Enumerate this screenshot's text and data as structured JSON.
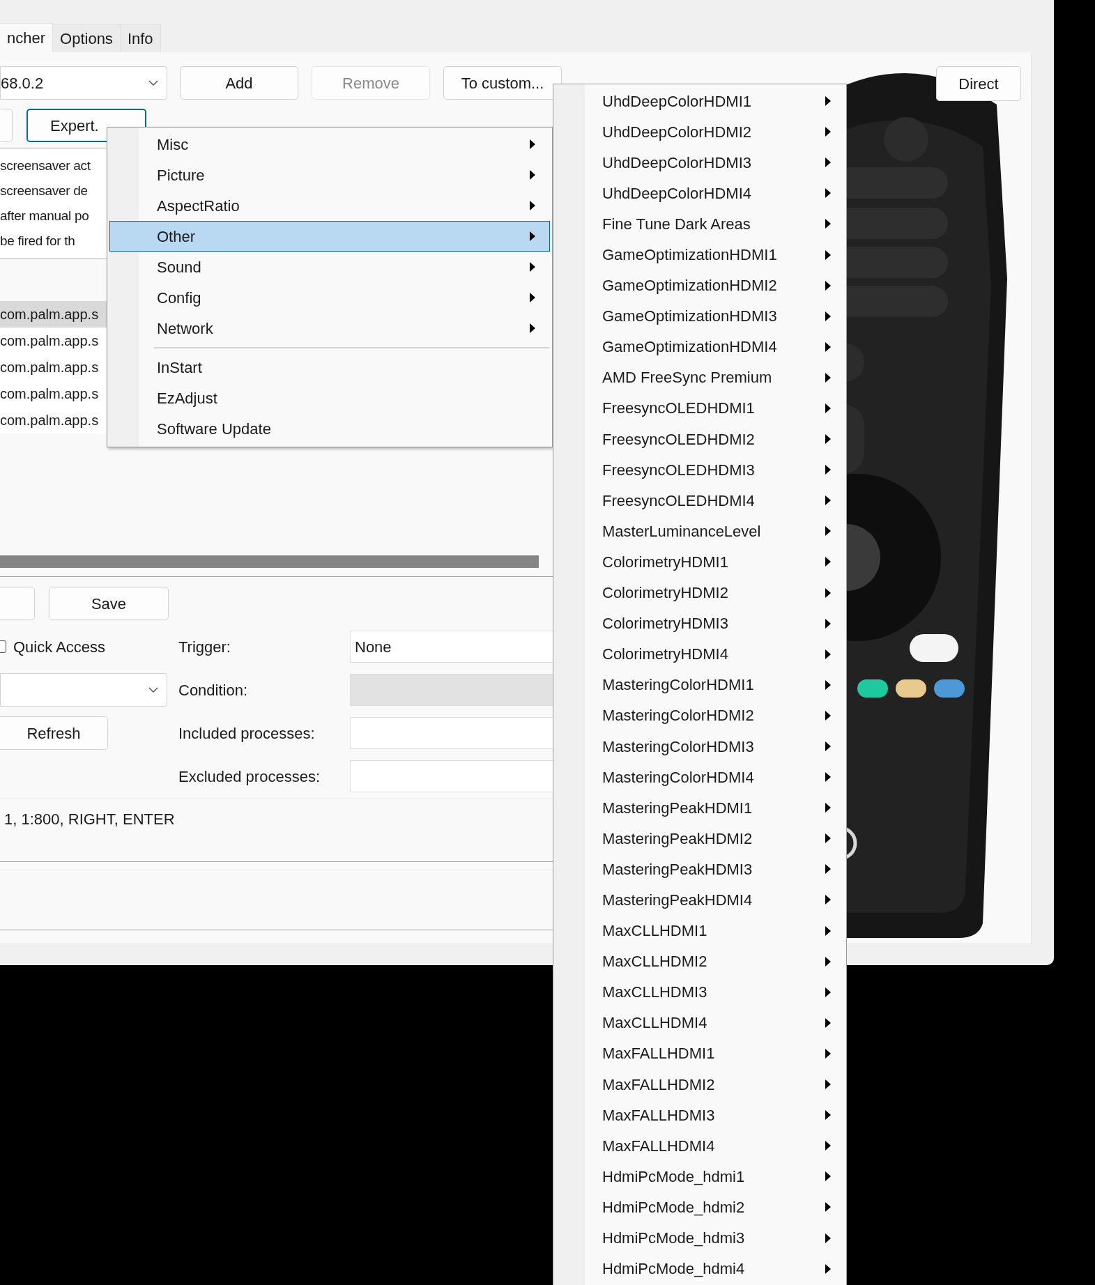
{
  "tabs": [
    {
      "label": "ncher",
      "selected": true
    },
    {
      "label": "Options",
      "selected": false
    },
    {
      "label": "Info",
      "selected": false
    }
  ],
  "toolbar": {
    "device": "68.0.2",
    "buttons": [
      {
        "label": "Add",
        "disabled": false
      },
      {
        "label": "Remove",
        "disabled": true
      },
      {
        "label": "To custom...",
        "disabled": false
      }
    ],
    "direct": "Direct",
    "expert": "Expert."
  },
  "events": [
    "screensaver act",
    "screensaver de",
    "after manual po",
    "be fired for th"
  ],
  "apps": [
    {
      "label": "com.palm.app.s",
      "selected": true
    },
    {
      "label": "com.palm.app.s",
      "selected": false
    },
    {
      "label": "com.palm.app.s",
      "selected": false
    },
    {
      "label": "com.palm.app.s",
      "selected": false
    },
    {
      "label": "com.palm.app.s",
      "selected": false
    }
  ],
  "save": "Save",
  "quick_access": {
    "label": "Quick Access",
    "checked": false
  },
  "refresh": "Refresh",
  "form": [
    {
      "label": "Trigger:",
      "value": "None",
      "disabled": false
    },
    {
      "label": "Condition:",
      "disabled": true
    },
    {
      "label": "Included processes:",
      "disabled": false
    },
    {
      "label": "Excluded processes:",
      "disabled": false
    }
  ],
  "commands": "1, 1:800, RIGHT, ENTER",
  "context_menu": {
    "groups": [
      [
        {
          "label": "Misc",
          "kind": "submenu",
          "selected": false
        },
        {
          "label": "Picture",
          "kind": "submenu",
          "selected": false
        },
        {
          "label": "AspectRatio",
          "kind": "submenu",
          "selected": false
        },
        {
          "label": "Other",
          "kind": "submenu",
          "selected": true
        },
        {
          "label": "Sound",
          "kind": "submenu",
          "selected": false
        },
        {
          "label": "Config",
          "kind": "submenu",
          "selected": false
        },
        {
          "label": "Network",
          "kind": "submenu",
          "selected": false
        }
      ],
      [
        {
          "label": "InStart",
          "kind": "command",
          "selected": false
        },
        {
          "label": "EzAdjust",
          "kind": "command",
          "selected": false
        },
        {
          "label": "Software Update",
          "kind": "command",
          "selected": false
        }
      ]
    ]
  },
  "submenu": {
    "items": [
      "UhdDeepColorHDMI1",
      "UhdDeepColorHDMI2",
      "UhdDeepColorHDMI3",
      "UhdDeepColorHDMI4",
      "Fine Tune Dark Areas",
      "GameOptimizationHDMI1",
      "GameOptimizationHDMI2",
      "GameOptimizationHDMI3",
      "GameOptimizationHDMI4",
      "AMD FreeSync Premium",
      "FreesyncOLEDHDMI1",
      "FreesyncOLEDHDMI2",
      "FreesyncOLEDHDMI3",
      "FreesyncOLEDHDMI4",
      "MasterLuminanceLevel",
      "ColorimetryHDMI1",
      "ColorimetryHDMI2",
      "ColorimetryHDMI3",
      "ColorimetryHDMI4",
      "MasteringColorHDMI1",
      "MasteringColorHDMI2",
      "MasteringColorHDMI3",
      "MasteringColorHDMI4",
      "MasteringPeakHDMI1",
      "MasteringPeakHDMI2",
      "MasteringPeakHDMI3",
      "MasteringPeakHDMI4",
      "MaxCLLHDMI1",
      "MaxCLLHDMI2",
      "MaxCLLHDMI3",
      "MaxCLLHDMI4",
      "MaxFALLHDMI1",
      "MaxFALLHDMI2",
      "MaxFALLHDMI3",
      "MaxFALLHDMI4",
      "HdmiPcMode_hdmi1",
      "HdmiPcMode_hdmi2",
      "HdmiPcMode_hdmi3",
      "HdmiPcMode_hdmi4"
    ]
  }
}
